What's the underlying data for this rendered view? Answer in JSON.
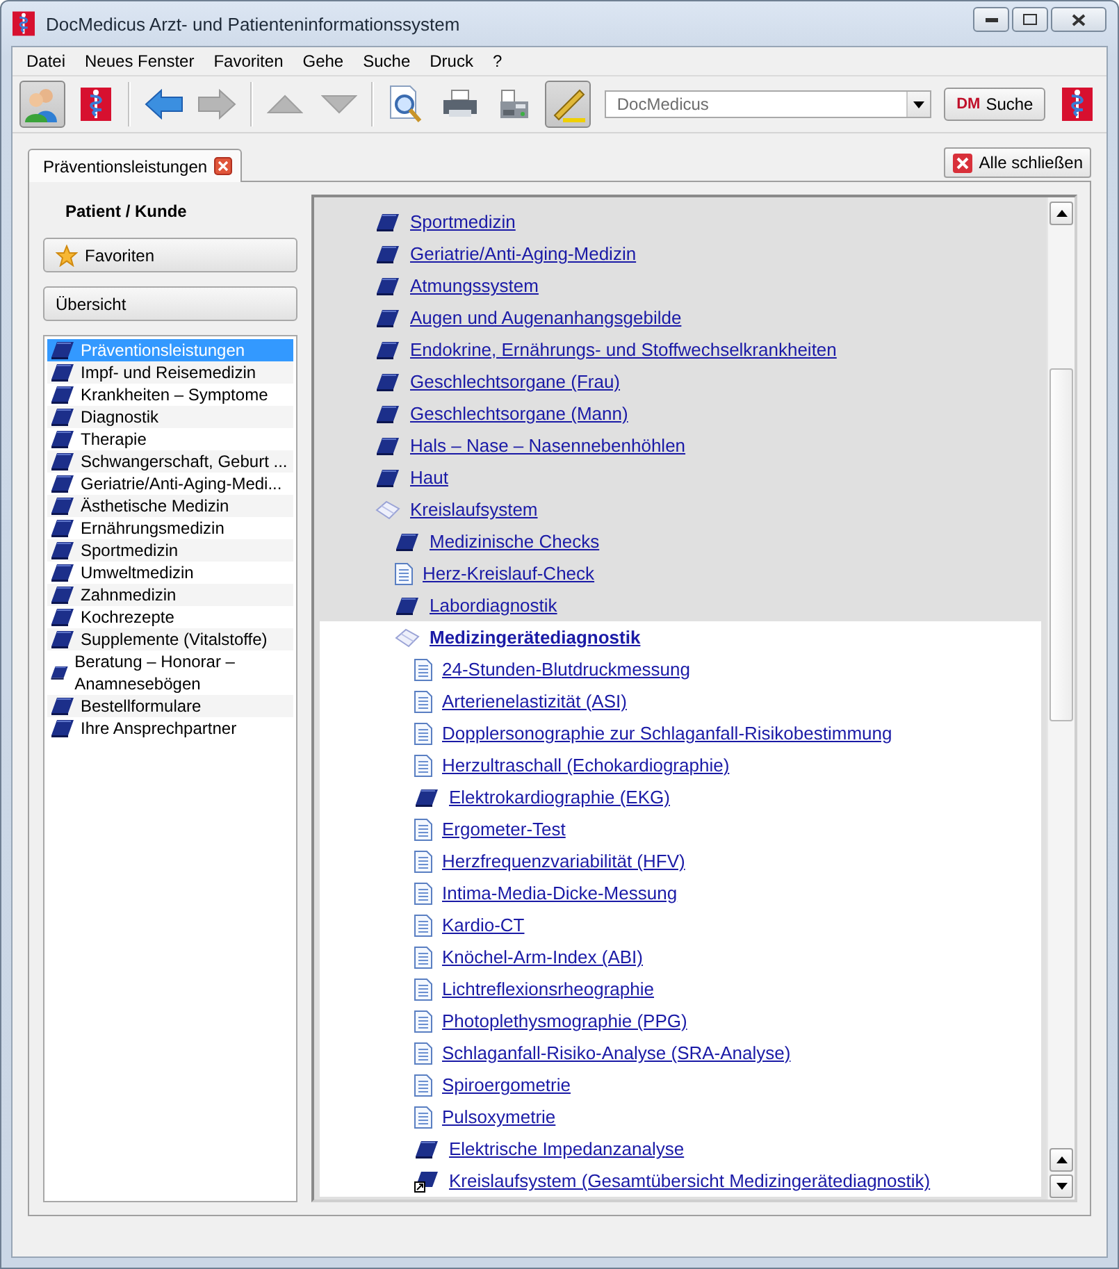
{
  "window": {
    "title": "DocMedicus Arzt- und Patienteninformationssystem"
  },
  "menu": [
    {
      "label": "Datei"
    },
    {
      "label": "Neues Fenster"
    },
    {
      "label": "Favoriten"
    },
    {
      "label": "Gehe"
    },
    {
      "label": "Suche"
    },
    {
      "label": "Druck"
    },
    {
      "label": "?"
    }
  ],
  "toolbar": {
    "buttons": [
      {
        "kind": "persons",
        "pressed": true,
        "disabled": false
      },
      {
        "kind": "logo",
        "pressed": false,
        "disabled": false
      },
      {
        "kind": "separator"
      },
      {
        "kind": "back",
        "pressed": false,
        "disabled": false
      },
      {
        "kind": "forward",
        "pressed": false,
        "disabled": true
      },
      {
        "kind": "separator"
      },
      {
        "kind": "up",
        "pressed": false,
        "disabled": true
      },
      {
        "kind": "down",
        "pressed": false,
        "disabled": true
      },
      {
        "kind": "separator"
      },
      {
        "kind": "preview",
        "pressed": false,
        "disabled": false
      },
      {
        "kind": "print",
        "pressed": false,
        "disabled": false
      },
      {
        "kind": "fax",
        "pressed": false,
        "disabled": false
      },
      {
        "kind": "pencil",
        "pressed": true,
        "disabled": false
      }
    ],
    "search_combo": {
      "value": "DocMedicus"
    },
    "search_button": {
      "prefix": "DM",
      "label": "Suche"
    }
  },
  "tabs": [
    {
      "label": "Präventionsleistungen",
      "selected": true
    }
  ],
  "close_all_button": "Alle schließen",
  "sidebar": {
    "heading": "Patient / Kunde",
    "favorites_button": "Favoriten",
    "overview_button": "Übersicht",
    "items": [
      {
        "label": "Präventionsleistungen",
        "selected": true
      },
      {
        "label": "Impf- und Reisemedizin",
        "selected": false
      },
      {
        "label": "Krankheiten – Symptome",
        "selected": false
      },
      {
        "label": "Diagnostik",
        "selected": false
      },
      {
        "label": "Therapie",
        "selected": false
      },
      {
        "label": "Schwangerschaft, Geburt ...",
        "selected": false
      },
      {
        "label": "Geriatrie/Anti-Aging-Medi...",
        "selected": false
      },
      {
        "label": "Ästhetische Medizin",
        "selected": false
      },
      {
        "label": "Ernährungsmedizin",
        "selected": false
      },
      {
        "label": "Sportmedizin",
        "selected": false
      },
      {
        "label": "Umweltmedizin",
        "selected": false
      },
      {
        "label": "Zahnmedizin",
        "selected": false
      },
      {
        "label": "Kochrezepte",
        "selected": false
      },
      {
        "label": "Supplemente (Vitalstoffe)",
        "selected": false
      },
      {
        "label": "Beratung – Honorar – Anamnesebögen",
        "selected": false
      },
      {
        "label": "Bestellformulare",
        "selected": false
      },
      {
        "label": "Ihre Ansprechpartner",
        "selected": false
      }
    ]
  },
  "tree": [
    {
      "kind": "book",
      "label": "Sportmedizin",
      "selected": false
    },
    {
      "kind": "book",
      "label": "Geriatrie/Anti-Aging-Medizin",
      "selected": false
    },
    {
      "kind": "book",
      "label": "Atmungssystem",
      "selected": false
    },
    {
      "kind": "book",
      "label": "Augen und Augenanhangsgebilde",
      "selected": false
    },
    {
      "kind": "book",
      "label": "Endokrine, Ernährungs- und Stoffwechselkrankheiten",
      "selected": false
    },
    {
      "kind": "book",
      "label": "Geschlechtsorgane (Frau)",
      "selected": false
    },
    {
      "kind": "book",
      "label": "Geschlechtsorgane (Mann)",
      "selected": false
    },
    {
      "kind": "book",
      "label": "Hals – Nase – Nasennebenhöhlen",
      "selected": false
    },
    {
      "kind": "book",
      "label": "Haut",
      "selected": false
    },
    {
      "kind": "openbook",
      "label": "Kreislaufsystem",
      "selected": false,
      "children": [
        {
          "kind": "book",
          "label": "Medizinische Checks",
          "selected": false
        },
        {
          "kind": "page",
          "label": "Herz-Kreislauf-Check",
          "selected": false
        },
        {
          "kind": "book",
          "label": "Labordiagnostik",
          "selected": false
        },
        {
          "kind": "openbook",
          "label": "Medizingerätediagnostik",
          "selected": true,
          "children": [
            {
              "kind": "page",
              "label": "24-Stunden-Blutdruckmessung",
              "selected": false
            },
            {
              "kind": "page",
              "label": "Arterienelastizität (ASI)",
              "selected": false
            },
            {
              "kind": "page",
              "label": "Dopplersonographie zur Schlaganfall-Risikobestimmung",
              "selected": false
            },
            {
              "kind": "page",
              "label": "Herzultraschall (Echokardiographie)",
              "selected": false
            },
            {
              "kind": "book",
              "label": "Elektrokardiographie (EKG)",
              "selected": false
            },
            {
              "kind": "page",
              "label": "Ergometer-Test",
              "selected": false
            },
            {
              "kind": "page",
              "label": "Herzfrequenzvariabilität (HFV)",
              "selected": false
            },
            {
              "kind": "page",
              "label": "Intima-Media-Dicke-Messung",
              "selected": false
            },
            {
              "kind": "page",
              "label": "Kardio-CT",
              "selected": false
            },
            {
              "kind": "page",
              "label": "Knöchel-Arm-Index (ABI)",
              "selected": false
            },
            {
              "kind": "page",
              "label": "Lichtreflexionsrheographie",
              "selected": false
            },
            {
              "kind": "page",
              "label": "Photoplethysmographie (PPG)",
              "selected": false
            },
            {
              "kind": "page",
              "label": "Schlaganfall-Risiko-Analyse (SRA-Analyse)",
              "selected": false
            },
            {
              "kind": "page",
              "label": "Spiroergometrie",
              "selected": false
            },
            {
              "kind": "page",
              "label": "Pulsoxymetrie",
              "selected": false
            },
            {
              "kind": "book",
              "label": "Elektrische Impedanzanalyse",
              "selected": false
            },
            {
              "kind": "shortcut",
              "label": "Kreislaufsystem (Gesamtübersicht Medizingerätediagnostik)",
              "selected": false
            }
          ]
        }
      ]
    }
  ]
}
